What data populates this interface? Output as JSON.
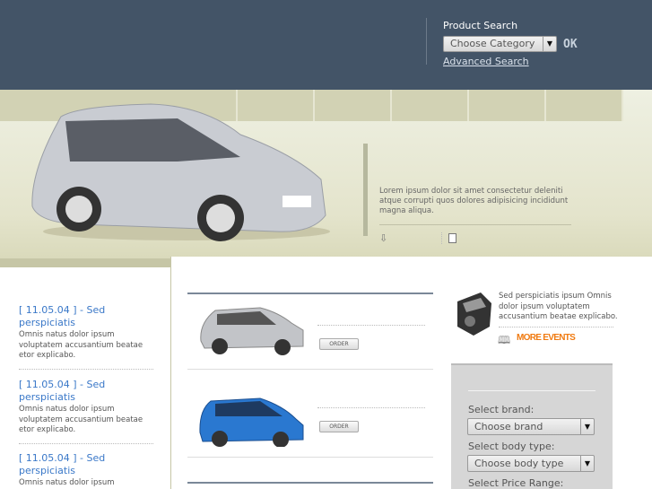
{
  "header": {
    "product_search_label": "Product Search",
    "category_select": "Choose Category",
    "ok_label": "OK",
    "advanced_search": "Advanced Search"
  },
  "hero": {
    "text": "Lorem ipsum dolor sit amet consectetur deleniti atque corrupti quos dolores adipisicing incididunt magna aliqua."
  },
  "news": [
    {
      "title": "[ 11.05.04 ] - Sed perspiciatis",
      "text": "Omnis natus dolor ipsum voluptatem accusantium beatae etor explicabo."
    },
    {
      "title": "[ 11.05.04 ] - Sed perspiciatis",
      "text": "Omnis natus dolor ipsum voluptatem accusantium beatae etor explicabo."
    },
    {
      "title": "[ 11.05.04 ] - Sed perspiciatis",
      "text": "Omnis natus dolor ipsum"
    }
  ],
  "products": [
    {
      "order_label": "ORDER",
      "color": "#b8bcc2"
    },
    {
      "order_label": "ORDER",
      "color": "#2a78d0"
    }
  ],
  "events": {
    "text": "Sed perspiciatis ipsum Omnis dolor ipsum voluptatem accusantium beatae explicabo.",
    "more_label": "MORE EVENTS",
    "accent": "#f07a10"
  },
  "filter": {
    "brand_label": "Select brand:",
    "brand_value": "Choose brand",
    "body_label": "Select body type:",
    "body_value": "Choose body type",
    "price_label": "Select Price Range:"
  }
}
